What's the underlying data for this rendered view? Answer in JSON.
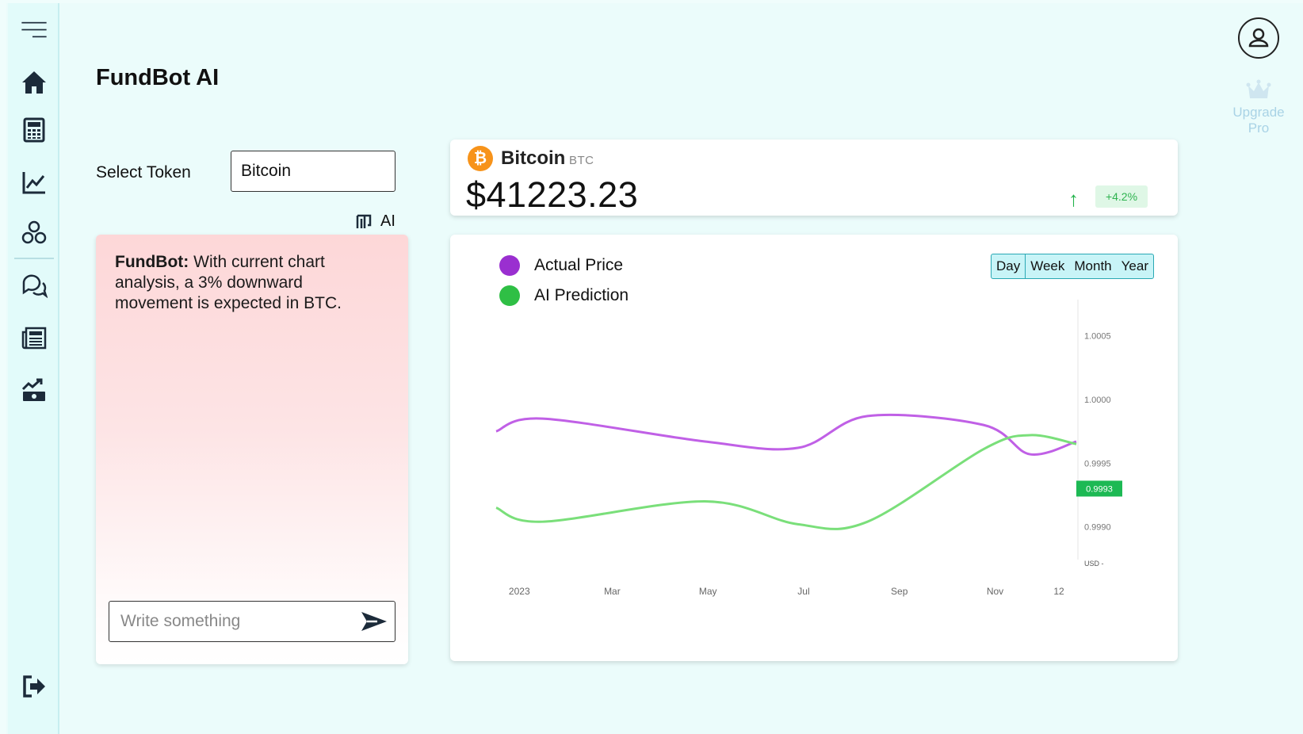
{
  "app": {
    "title": "FundBot AI"
  },
  "sidebar": {
    "items": [
      {
        "name": "menu-icon"
      },
      {
        "name": "home-icon"
      },
      {
        "name": "calculator-icon"
      },
      {
        "name": "chart-line-icon"
      },
      {
        "name": "nodes-icon"
      },
      {
        "name": "chat-icon"
      },
      {
        "name": "news-icon"
      },
      {
        "name": "growth-icon"
      },
      {
        "name": "logout-icon"
      }
    ]
  },
  "header": {
    "upgrade_line1": "Upgrade",
    "upgrade_line2": "Pro"
  },
  "token": {
    "label": "Select Token",
    "value": "Bitcoin"
  },
  "ai_tag": "AI",
  "chat": {
    "sender": "FundBot:",
    "message": " With current chart analysis, a 3% downward movement is expected in BTC.",
    "input_placeholder": "Write something"
  },
  "price_card": {
    "coin_name": "Bitcoin",
    "coin_symbol": "BTC",
    "price": "$41223.23",
    "change": "+4.2%",
    "change_color": "#21b34a"
  },
  "chart_controls": {
    "ranges": [
      "Day",
      "Week",
      "Month",
      "Year"
    ]
  },
  "chart_data": {
    "type": "line",
    "x": [
      "2023",
      "Mar",
      "May",
      "Jul",
      "Sep",
      "Nov",
      "12"
    ],
    "y_ticks": [
      "1.0005",
      "1.0000",
      "0.9995",
      "0.9990"
    ],
    "y_unit": "USD",
    "ylim": [
      0.99868,
      1.00071
    ],
    "current_value_label": "0.9993",
    "current_value": 0.9993,
    "series": [
      {
        "name": "Actual Price",
        "color": "#c060e6",
        "legend_color": "#9a2fd0",
        "values": [
          0.99975,
          0.99985,
          0.99967,
          0.99962,
          0.99987,
          0.9998,
          0.99957,
          0.99967
        ]
      },
      {
        "name": "AI Prediction",
        "color": "#7adf7a",
        "legend_color": "#2fbf45",
        "values": [
          0.99915,
          0.99904,
          0.9992,
          0.99902,
          0.99904,
          0.99961,
          0.99972,
          0.99965
        ]
      }
    ],
    "series_x": [
      0,
      0.08,
      0.36,
      0.52,
      0.64,
      0.84,
      0.92,
      1.0
    ],
    "legend_position": "top-left",
    "grid": false
  }
}
